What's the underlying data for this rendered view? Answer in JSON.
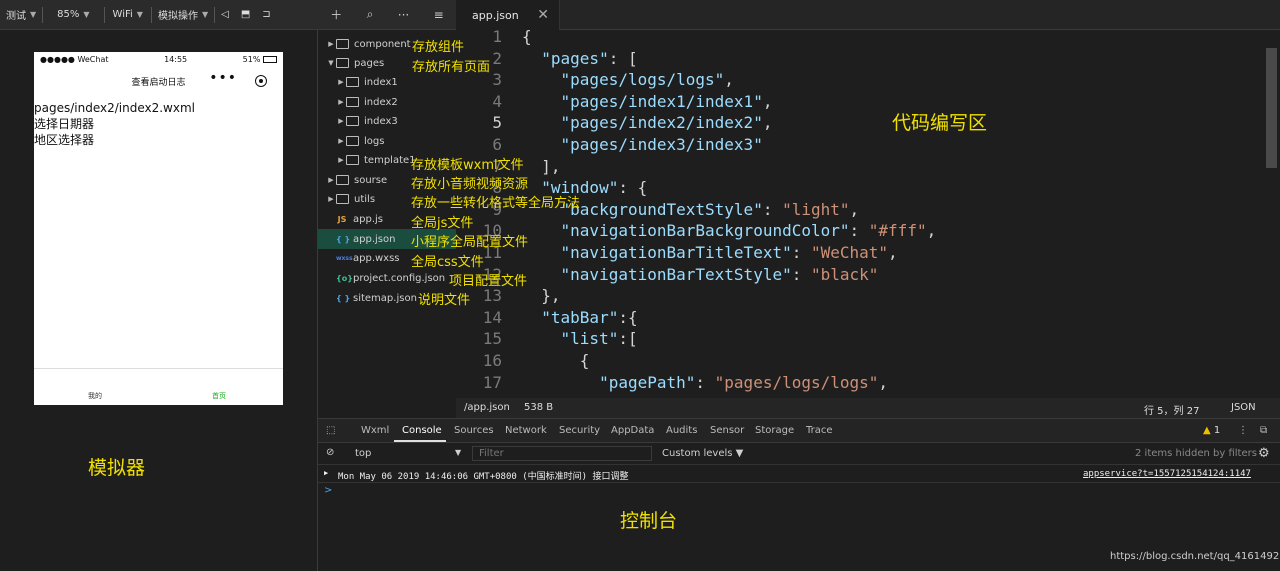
{
  "sim_toolbar": {
    "items": [
      "测试",
      "85%",
      "WiFi",
      "模拟操作"
    ]
  },
  "tree_toolbar": {
    "icons": [
      "plus-icon",
      "search-icon",
      "more-icon",
      "collapse-icon"
    ]
  },
  "editor_tab": {
    "label": "app.json",
    "close": "✕"
  },
  "phone": {
    "status_left": "●●●●● WeChat",
    "status_time": "14:55",
    "status_right": "51%",
    "nav_title": "查看启动日志",
    "nav_dots": "•••",
    "body_lines": [
      "pages/index2/index2.wxml",
      "选择日期器",
      "地区选择器"
    ],
    "tab_left": "我的",
    "tab_right": "首页"
  },
  "annotations": {
    "simulator": "模拟器",
    "editor": "代码编写区",
    "console": "控制台",
    "component": "存放组件",
    "pages": "存放所有页面",
    "template": "存放模板wxml文件",
    "sourse": "存放小音频视频资源",
    "utils": "存放一些转化格式等全局方法",
    "appjs": "全局js文件",
    "appjson": "小程序全局配置文件",
    "appwxss": "全局css文件",
    "project": "项目配置文件",
    "sitemap": "说明文件"
  },
  "tree": [
    {
      "label": "component",
      "type": "folder",
      "level": 0
    },
    {
      "label": "pages",
      "type": "folder-open",
      "level": 0
    },
    {
      "label": "index1",
      "type": "folder",
      "level": 1
    },
    {
      "label": "index2",
      "type": "folder",
      "level": 1
    },
    {
      "label": "index3",
      "type": "folder",
      "level": 1
    },
    {
      "label": "logs",
      "type": "folder",
      "level": 1
    },
    {
      "label": "template1",
      "type": "folder",
      "level": 1
    },
    {
      "label": "sourse",
      "type": "folder",
      "level": 0
    },
    {
      "label": "utils",
      "type": "folder",
      "level": 0
    },
    {
      "label": "app.js",
      "type": "js",
      "icon": "JS",
      "level": 0
    },
    {
      "label": "app.json",
      "type": "json",
      "icon": "{ }",
      "level": 0
    },
    {
      "label": "app.wxss",
      "type": "wxss",
      "icon": "wxss",
      "level": 0
    },
    {
      "label": "project.config.json",
      "type": "cfg",
      "icon": "{o}",
      "level": 0
    },
    {
      "label": "sitemap.json",
      "type": "json",
      "icon": "{ }",
      "level": 0
    }
  ],
  "code": {
    "line_numbers": [
      "1",
      "2",
      "3",
      "4",
      "5",
      "6",
      "7",
      "8",
      "9",
      "10",
      "11",
      "12",
      "13",
      "14",
      "15",
      "16",
      "17"
    ],
    "lines": [
      "{",
      "  \"pages\": [",
      "    \"pages/logs/logs\",",
      "    \"pages/index1/index1\",",
      "    \"pages/index2/index2\",",
      "    \"pages/index3/index3\"",
      "  ],",
      "  \"window\": {",
      "    \"backgroundTextStyle\": \"light\",",
      "    \"navigationBarBackgroundColor\": \"#fff\",",
      "    \"navigationBarTitleText\": \"WeChat\",",
      "    \"navigationBarTextStyle\": \"black\"",
      "  },",
      "  \"tabBar\":{",
      "    \"list\":[",
      "      {",
      "        \"pagePath\": \"pages/logs/logs\","
    ]
  },
  "status_bar": {
    "path": "/app.json",
    "size": "538 B",
    "position": "行 5，列 27",
    "lang": "JSON"
  },
  "devtools": {
    "tabs": [
      "Wxml",
      "Console",
      "Sources",
      "Network",
      "Security",
      "AppData",
      "Audits",
      "Sensor",
      "Storage",
      "Trace"
    ],
    "active_tab": "Console",
    "warn_count": "1",
    "context": "top",
    "filter_placeholder": "Filter",
    "levels": "Custom levels",
    "hidden": "2 items hidden by filters",
    "log_text": "Mon May 06 2019 14:46:06 GMT+0800 (中国标准时间) 接口调整",
    "log_source": "appservice?t=1557125154124:1147",
    "prompt": ">"
  },
  "watermark": "https://blog.csdn.net/qq_41614928",
  "colors": {
    "accent": "#f0e000",
    "selection": "#1b4d3e",
    "tabbar_active": "#1aad19"
  }
}
